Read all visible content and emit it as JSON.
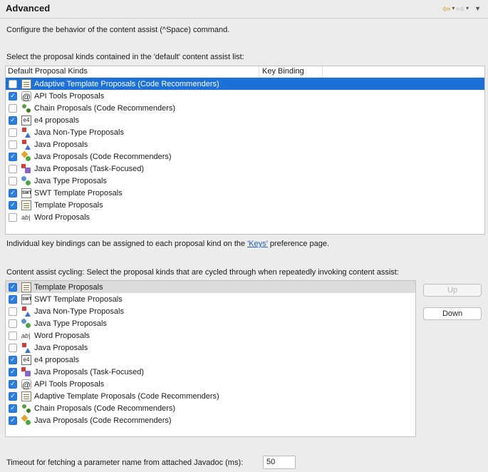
{
  "header": {
    "title": "Advanced"
  },
  "nav": {
    "back": "⇦",
    "forward": "⇨",
    "dropdown": "▾",
    "menu": "▼"
  },
  "intro": "Configure the behavior of the content assist (^Space) command.",
  "default_list": {
    "caption": "Select the proposal kinds contained in the 'default' content assist list:",
    "col_kinds": "Default Proposal Kinds",
    "col_binding": "Key Binding",
    "items": [
      {
        "label": "Adaptive Template Proposals (Code Recommenders)",
        "checked": false,
        "icon": "template-icon"
      },
      {
        "label": "API Tools Proposals",
        "checked": true,
        "icon": "at-icon"
      },
      {
        "label": "Chain Proposals (Code Recommenders)",
        "checked": false,
        "icon": "chain-icon"
      },
      {
        "label": "e4 proposals",
        "checked": true,
        "icon": "e4-icon"
      },
      {
        "label": "Java Non-Type Proposals",
        "checked": false,
        "icon": "java-icon"
      },
      {
        "label": "Java Proposals",
        "checked": false,
        "icon": "java-icon"
      },
      {
        "label": "Java Proposals (Code Recommenders)",
        "checked": true,
        "icon": "java-recommenders-icon"
      },
      {
        "label": "Java Proposals (Task-Focused)",
        "checked": false,
        "icon": "java-task-icon"
      },
      {
        "label": "Java Type Proposals",
        "checked": false,
        "icon": "java-type-icon"
      },
      {
        "label": "SWT Template Proposals",
        "checked": true,
        "icon": "swt-icon"
      },
      {
        "label": "Template Proposals",
        "checked": true,
        "icon": "template-icon"
      },
      {
        "label": "Word Proposals",
        "checked": false,
        "icon": "word-icon"
      }
    ]
  },
  "keys_note": {
    "before": "Individual key bindings can be assigned to each proposal kind on the ",
    "link": "'Keys'",
    "after": " preference page."
  },
  "cycling": {
    "caption": "Content assist cycling: Select the proposal kinds that are cycled through when repeatedly invoking content assist:",
    "items": [
      {
        "label": "Template Proposals",
        "checked": true,
        "icon": "template-icon"
      },
      {
        "label": "SWT Template Proposals",
        "checked": true,
        "icon": "swt-icon"
      },
      {
        "label": "Java Non-Type Proposals",
        "checked": false,
        "icon": "java-icon"
      },
      {
        "label": "Java Type Proposals",
        "checked": false,
        "icon": "java-type-icon"
      },
      {
        "label": "Word Proposals",
        "checked": false,
        "icon": "word-icon"
      },
      {
        "label": "Java Proposals",
        "checked": false,
        "icon": "java-icon"
      },
      {
        "label": "e4 proposals",
        "checked": true,
        "icon": "e4-icon"
      },
      {
        "label": "Java Proposals (Task-Focused)",
        "checked": true,
        "icon": "java-task-icon"
      },
      {
        "label": "API Tools Proposals",
        "checked": true,
        "icon": "at-icon"
      },
      {
        "label": "Adaptive Template Proposals (Code Recommenders)",
        "checked": true,
        "icon": "template-icon"
      },
      {
        "label": "Chain Proposals (Code Recommenders)",
        "checked": true,
        "icon": "chain-icon"
      },
      {
        "label": "Java Proposals (Code Recommenders)",
        "checked": true,
        "icon": "java-recommenders-icon"
      }
    ],
    "up_label": "Up",
    "down_label": "Down"
  },
  "timeout": {
    "label": "Timeout for fetching a parameter name from attached Javadoc (ms):",
    "value": "50"
  },
  "colors": {
    "selection_blue": "#1d70d6",
    "checkbox_blue": "#2a7de1",
    "link": "#1b5bc2"
  }
}
